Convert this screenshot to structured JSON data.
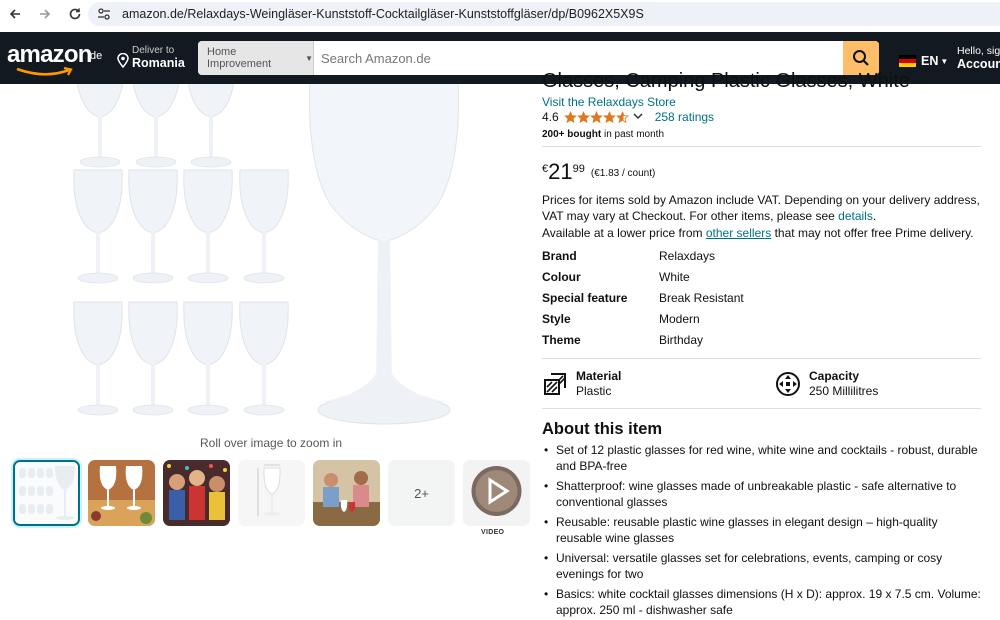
{
  "browser": {
    "url": "amazon.de/Relaxdays-Weingläser-Kunststoff-Cocktailgläser-Kunststoffgläser/dp/B0962X5X9S"
  },
  "header": {
    "logo_text": "amazon",
    "logo_tld": ".de",
    "deliver_line1": "Deliver to",
    "deliver_line2": "Romania",
    "search_category": "Home Improvement",
    "search_placeholder": "Search Amazon.de",
    "language": "EN",
    "account_line1": "Hello, sign",
    "account_line2": "Account"
  },
  "gallery": {
    "zoom_note": "Roll over image to zoom in",
    "more_label": "2+",
    "video_label": "VIDEO"
  },
  "product": {
    "title": "Glasses, Camping Plastic Glasses, White",
    "store_link": "Visit the Relaxdays Store",
    "rating_value": "4.6",
    "rating_stars": 4.6,
    "rating_count": "258 ratings",
    "bought_bold": "200+ bought",
    "bought_rest": "in past month",
    "price_currency": "€",
    "price_whole": "21",
    "price_fraction": "99",
    "price_unit": "(€1.83 / count)",
    "vat_note": "Prices for items sold by Amazon include VAT. Depending on your delivery address, VAT may vary at Checkout. For other items, please see",
    "vat_link": "details",
    "vat_end": ".",
    "other_prefix": "Available at a lower price from",
    "other_link": "other sellers",
    "other_suffix": "that may not offer free Prime delivery."
  },
  "specs": [
    {
      "key": "Brand",
      "value": "Relaxdays"
    },
    {
      "key": "Colour",
      "value": "White"
    },
    {
      "key": "Special feature",
      "value": "Break Resistant"
    },
    {
      "key": "Style",
      "value": "Modern"
    },
    {
      "key": "Theme",
      "value": "Birthday"
    }
  ],
  "features": [
    {
      "label": "Material",
      "value": "Plastic",
      "icon": "material-icon"
    },
    {
      "label": "Capacity",
      "value": "250 Millilitres",
      "icon": "capacity-icon"
    }
  ],
  "about": {
    "heading": "About this item",
    "bullets": [
      "Set of 12 plastic glasses for red wine, white wine and cocktails - robust, durable and BPA-free",
      "Shatterproof: wine glasses made of unbreakable plastic - safe alternative to conventional glasses",
      "Reusable: reusable plastic wine glasses in elegant design – high-quality reusable wine glasses",
      "Universal: versatile glasses set for celebrations, events, camping or cosy evenings for two",
      "Basics: white cocktail glasses dimensions (H x D): approx. 19 x 7.5 cm. Volume: approx. 250 ml - dishwasher safe"
    ]
  },
  "colors": {
    "header_bg": "#131921",
    "search_button": "#febd69",
    "link": "#007185",
    "star": "#de7921"
  }
}
